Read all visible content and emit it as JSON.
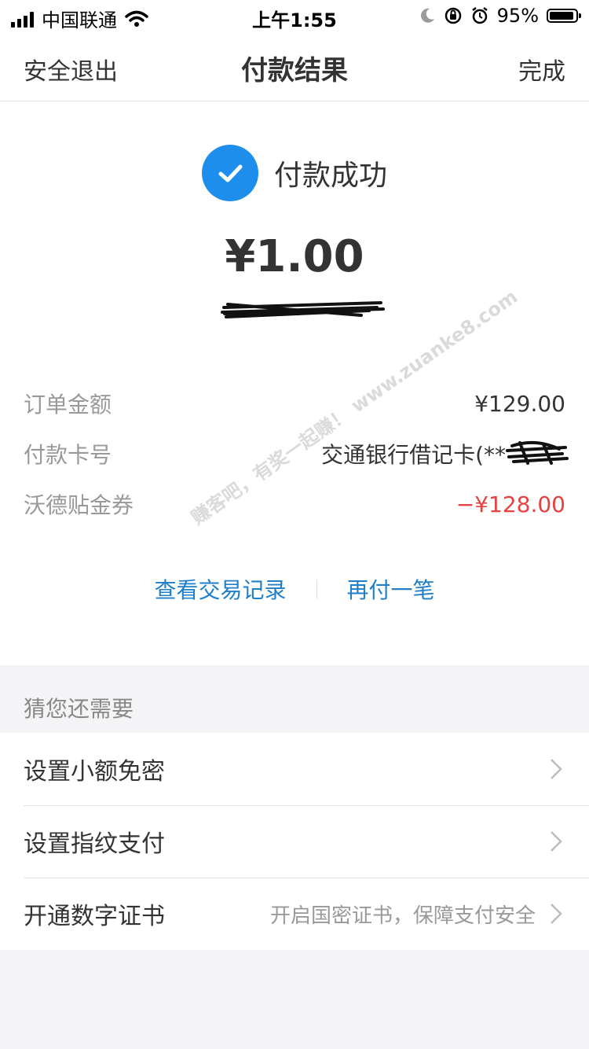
{
  "status_bar": {
    "carrier": "中国联通",
    "time": "上午1:55",
    "battery_percent": "95%",
    "battery_level": 0.95,
    "icons": [
      "signal-icon",
      "wifi-icon",
      "moon-icon",
      "orientation-lock-icon",
      "alarm-icon",
      "battery-icon"
    ]
  },
  "nav": {
    "left": "安全退出",
    "title": "付款结果",
    "right": "完成"
  },
  "result": {
    "status_text": "付款成功",
    "amount": "¥1.00",
    "check_color": "#1e8eed"
  },
  "details": [
    {
      "label": "订单金额",
      "value": "¥129.00"
    },
    {
      "label": "付款卡号",
      "value": "交通银行借记卡(**"
    },
    {
      "label": "沃德贴金券",
      "value": "−¥128.00"
    }
  ],
  "links": {
    "view_records": "查看交易记录",
    "pay_again": "再付一笔",
    "link_color": "#1f7fc9"
  },
  "watermark": "赚客吧，有奖一起赚！ www.zuanke8.com",
  "suggestions": {
    "header": "猜您还需要",
    "items": [
      {
        "label": "设置小额免密",
        "desc": ""
      },
      {
        "label": "设置指纹支付",
        "desc": ""
      },
      {
        "label": "开通数字证书",
        "desc": "开启国密证书，保障支付安全"
      }
    ]
  }
}
